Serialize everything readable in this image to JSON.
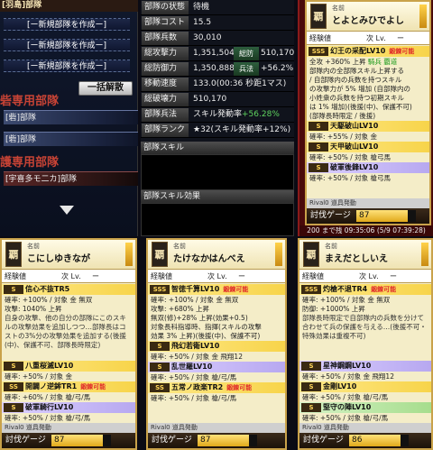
{
  "left": {
    "title": "[羽島]部隊",
    "create_label": "[ー新規部隊を作成ー]",
    "disband_label": "一括解散",
    "section1": "砦専用部隊",
    "units1": [
      "[砦]部隊",
      "[砦]部隊"
    ],
    "section2": "護専用部隊",
    "units2": [
      "[宇喜多モ二カ]部隊"
    ]
  },
  "stats": {
    "rows": [
      {
        "label": "部隊の状態",
        "value": "待機"
      },
      {
        "label": "部隊コスト",
        "value": "15.5"
      },
      {
        "label": "部隊兵数",
        "value": "30,010"
      },
      {
        "label": "総攻撃力",
        "value": "1,351,504",
        "label2": "総防",
        "value2": "510,170"
      },
      {
        "label": "総防御力",
        "value": "1,350,888",
        "label2": "兵法",
        "value2": "+56.2%"
      },
      {
        "label": "移動速度",
        "value": "133.0(00:36 秒距1マス)"
      },
      {
        "label": "総破壊力",
        "value": "510,170"
      },
      {
        "label": "部隊兵法",
        "value": "スキル発動率",
        "value_green": "+56.28%"
      },
      {
        "label": "部隊ランク",
        "value": "★32(スキル発動率+12%)"
      }
    ],
    "skill_header": "部隊スキル",
    "effect_header": "部隊スキル効果"
  },
  "cards": [
    {
      "id": "tr",
      "emblem": "覇",
      "name_label": "名前",
      "name": "とよとみひでよし",
      "exp_label": "経験値",
      "lv_label": "次 Lv.",
      "lv": "ー",
      "skills": [
        {
          "badge": "SSS",
          "name": "幻王の采配LV10",
          "tag": "鍛錬可能",
          "color": "yel"
        }
      ],
      "lines": [
        {
          "text": "全攻 +360% 上昇",
          "extra": "騎兵 覇道"
        },
        {
          "text": "部隊内の全部隊スキル上昇する"
        },
        {
          "text": "/ 自部隊内の兵数を持つスキル"
        },
        {
          "text": "の攻撃力が 5% 増加 (自部隊内の"
        },
        {
          "text": "小姓衆の兵数を持つ初期スキル"
        },
        {
          "text": "は 1% 増加)(後援(中)、保護不可)"
        },
        {
          "text": "(部隊長時限定 / 後援)"
        }
      ],
      "skills2": [
        {
          "badge": "S",
          "name": "天駆破山LV10",
          "tag": "",
          "color": "yel"
        },
        {
          "badge": "S",
          "name": "天甲破山LV10",
          "tag": "",
          "color": "yel"
        },
        {
          "badge": "S",
          "name": "破軍後鋒LV10",
          "tag": "",
          "color": "pur"
        }
      ],
      "small_lines": [
        {
          "text": "確率: +55% / 対象 金"
        },
        {
          "text": "確率: +50% / 対象 槍弓馬"
        },
        {
          "text": "確率: +50% / 対象 槍弓馬"
        }
      ],
      "lead": "Rival0 道具発動",
      "cost_label": "討伐ゲージ",
      "cost_value": "87",
      "cost_pct": 87,
      "time": "200 まで残 09:35:06 (5/9 07:39:28)"
    },
    {
      "id": "c1",
      "emblem": "覇",
      "name_label": "名前",
      "name": "こにしゆきなが",
      "exp_label": "経験値",
      "lv_label": "次 Lv.",
      "lv": "ー",
      "skills": [
        {
          "badge": "S",
          "name": "信心不抜TR5",
          "tag": "",
          "color": "yel"
        }
      ],
      "lines": [
        {
          "text": "確率: +100% / 対象 金 無双"
        },
        {
          "text": "攻撃: 1040% 上昇"
        }
      ],
      "desc": "自身の攻撃、他の自分の部隊にこのスキルの攻撃効果を追加しつつ…部隊長はコストの3%分の攻撃効果を追加する(後援(中)、保護不可、部隊長時限定)",
      "skills2": [
        {
          "badge": "S",
          "name": "八重桜滅LV10",
          "tag": "",
          "color": "yel"
        },
        {
          "badge": "SS",
          "name": "開闢ノ逆鉾TR1",
          "tag": "鍛錬可能",
          "color": "yel"
        },
        {
          "badge": "S",
          "name": "破軍騎行LV10",
          "tag": "",
          "color": "pur"
        }
      ],
      "small_lines": [
        {
          "text": "確率: +50% / 対象 金"
        },
        {
          "text": "確率: +60% / 対象 槍/弓/馬"
        },
        {
          "text": "確率: +50% / 対象 槍/弓/馬"
        }
      ],
      "lead": "Rival0 道具発動",
      "cost_label": "討伐ゲージ",
      "cost_value": "87",
      "cost_pct": 87
    },
    {
      "id": "c2",
      "emblem": "覇",
      "name_label": "名前",
      "name": "たけなかはんべえ",
      "exp_label": "経験値",
      "lv_label": "次 Lv.",
      "lv": "ー",
      "skills": [
        {
          "badge": "SSS",
          "name": "智徳千算LV10",
          "tag": "鍛錬可能",
          "color": "yel"
        }
      ],
      "lines": [
        {
          "text": "確率: +100% / 対象 金 無双"
        },
        {
          "text": "攻撃: +680% 上昇"
        },
        {
          "text": "無双(修)+28% 上昇(効果+0.5)"
        },
        {
          "text": "対象長科指導時、指揮(スキルの攻撃"
        },
        {
          "text": "効果 3% 上昇)(後援(中)、保護不可)"
        }
      ],
      "skills2": [
        {
          "badge": "S",
          "name": "飛幻若衛LV10",
          "tag": "",
          "color": "yel"
        },
        {
          "badge": "S",
          "name": "乱世羅LV10",
          "tag": "",
          "color": "pur"
        },
        {
          "badge": "SS",
          "name": "五常ノ政楽TR2",
          "tag": "鍛錬可能",
          "color": "yel"
        }
      ],
      "small_lines": [
        {
          "text": "確率: +50% / 対象 金 飛翔12"
        },
        {
          "text": "確率: +50% / 対象 槍/弓/馬"
        },
        {
          "text": "確率: +50% / 対象 槍/弓/馬"
        }
      ],
      "lead": "Rival0 道具発動",
      "cost_label": "討伐ゲージ",
      "cost_value": "87",
      "cost_pct": 87
    },
    {
      "id": "c3",
      "emblem": "覇",
      "name_label": "名前",
      "name": "まえだとしいえ",
      "exp_label": "経験値",
      "lv_label": "次 Lv.",
      "lv": "ー",
      "skills": [
        {
          "badge": "SSS",
          "name": "灼槍不退TR4",
          "tag": "鍛錬可能",
          "color": "yel"
        }
      ],
      "lines": [
        {
          "text": "確率: +100% / 対象 金 無双"
        },
        {
          "text": "防御: +1000% 上昇"
        }
      ],
      "desc": "部隊長時限定で自部隊内の兵数を分けて合わせて兵の保護を与える…(後援不可・特殊効果は重複不可)",
      "skills2": [
        {
          "badge": "S",
          "name": "星神鋼鋼LV10",
          "tag": "",
          "color": "pur"
        },
        {
          "badge": "S",
          "name": "金剛LV10",
          "tag": "",
          "color": "yel"
        },
        {
          "badge": "S",
          "name": "堅守の陣LV10",
          "tag": "",
          "color": "grn"
        }
      ],
      "small_lines": [
        {
          "text": "確率: +50% / 対象 金 飛翔12"
        },
        {
          "text": "確率: +50% / 対象 槍/弓/馬"
        },
        {
          "text": "確率: +50% / 対象 槍/弓/馬"
        }
      ],
      "lead": "Rival0 道具発動",
      "cost_label": "討伐ゲージ",
      "cost_value": "86",
      "cost_pct": 86
    }
  ]
}
